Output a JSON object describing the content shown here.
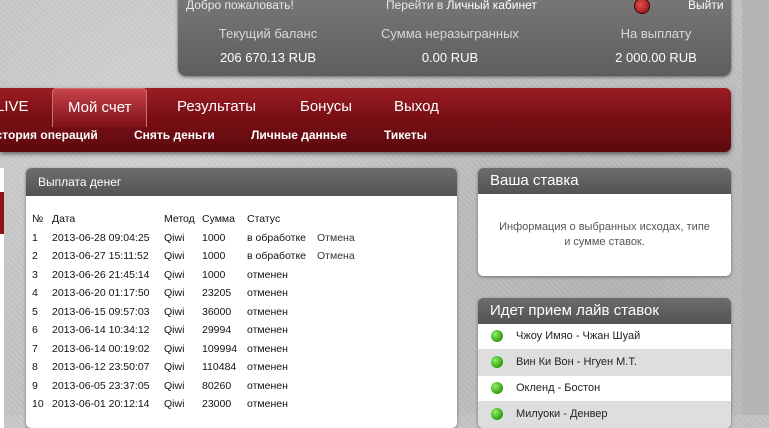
{
  "header": {
    "greeting": "Добро пожаловать!",
    "cabinet_prefix": "Перейти в",
    "cabinet_link": "Личный кабинет",
    "logout": "Выйти",
    "stats": [
      {
        "label": "Текущий баланс",
        "value": "206 670.13 RUB"
      },
      {
        "label": "Сумма неразыгранных",
        "value": "0.00 RUB"
      },
      {
        "label": "На выплату",
        "value": "2 000.00 RUB"
      }
    ]
  },
  "nav": {
    "items": [
      "LIVE",
      "Мой счет",
      "Результаты",
      "Бонусы",
      "Выход"
    ],
    "active": "Мой счет",
    "subitems": [
      "История операций",
      "Снять деньги",
      "Личные данные",
      "Тикеты"
    ]
  },
  "payout": {
    "title": "Выплата денег",
    "columns": [
      "№",
      "Дата",
      "Метод",
      "Сумма",
      "Статус"
    ],
    "rows": [
      {
        "no": "1",
        "date": "2013-06-28 09:04:25",
        "method": "Qiwi",
        "sum": "1000",
        "status": "в обработке",
        "action": "Отмена"
      },
      {
        "no": "2",
        "date": "2013-06-27 15:11:52",
        "method": "Qiwi",
        "sum": "1000",
        "status": "в обработке",
        "action": "Отмена"
      },
      {
        "no": "3",
        "date": "2013-06-26 21:45:14",
        "method": "Qiwi",
        "sum": "1000",
        "status": "отменен",
        "action": ""
      },
      {
        "no": "4",
        "date": "2013-06-20 01:17:50",
        "method": "Qiwi",
        "sum": "23205",
        "status": "отменен",
        "action": ""
      },
      {
        "no": "5",
        "date": "2013-06-15 09:57:03",
        "method": "Qiwi",
        "sum": "36000",
        "status": "отменен",
        "action": ""
      },
      {
        "no": "6",
        "date": "2013-06-14 10:34:12",
        "method": "Qiwi",
        "sum": "29994",
        "status": "отменен",
        "action": ""
      },
      {
        "no": "7",
        "date": "2013-06-14 00:19:02",
        "method": "Qiwi",
        "sum": "109994",
        "status": "отменен",
        "action": ""
      },
      {
        "no": "8",
        "date": "2013-06-12 23:50:07",
        "method": "Qiwi",
        "sum": "110484",
        "status": "отменен",
        "action": ""
      },
      {
        "no": "9",
        "date": "2013-06-05 23:37:05",
        "method": "Qiwi",
        "sum": "80260",
        "status": "отменен",
        "action": ""
      },
      {
        "no": "10",
        "date": "2013-06-01 20:12:14",
        "method": "Qiwi",
        "sum": "23000",
        "status": "отменен",
        "action": ""
      }
    ]
  },
  "bet_slip": {
    "title": "Ваша ставка",
    "info": "Информация о выбранных исходах, типе и сумме ставок."
  },
  "live": {
    "title": "Идет прием лайв ставок",
    "items": [
      "Чжоу Имяо - Чжан Шуай",
      "Вин Ки Вон - Нгуен М.Т.",
      "Окленд - Бостон",
      "Милуоки - Денвер"
    ]
  },
  "colors": {
    "nav_red": "#7a0f15",
    "panel_gray": "#5e5e5e",
    "live_green": "#3fb516"
  },
  "icons": [
    "logout-icon",
    "live-status-icon"
  ]
}
